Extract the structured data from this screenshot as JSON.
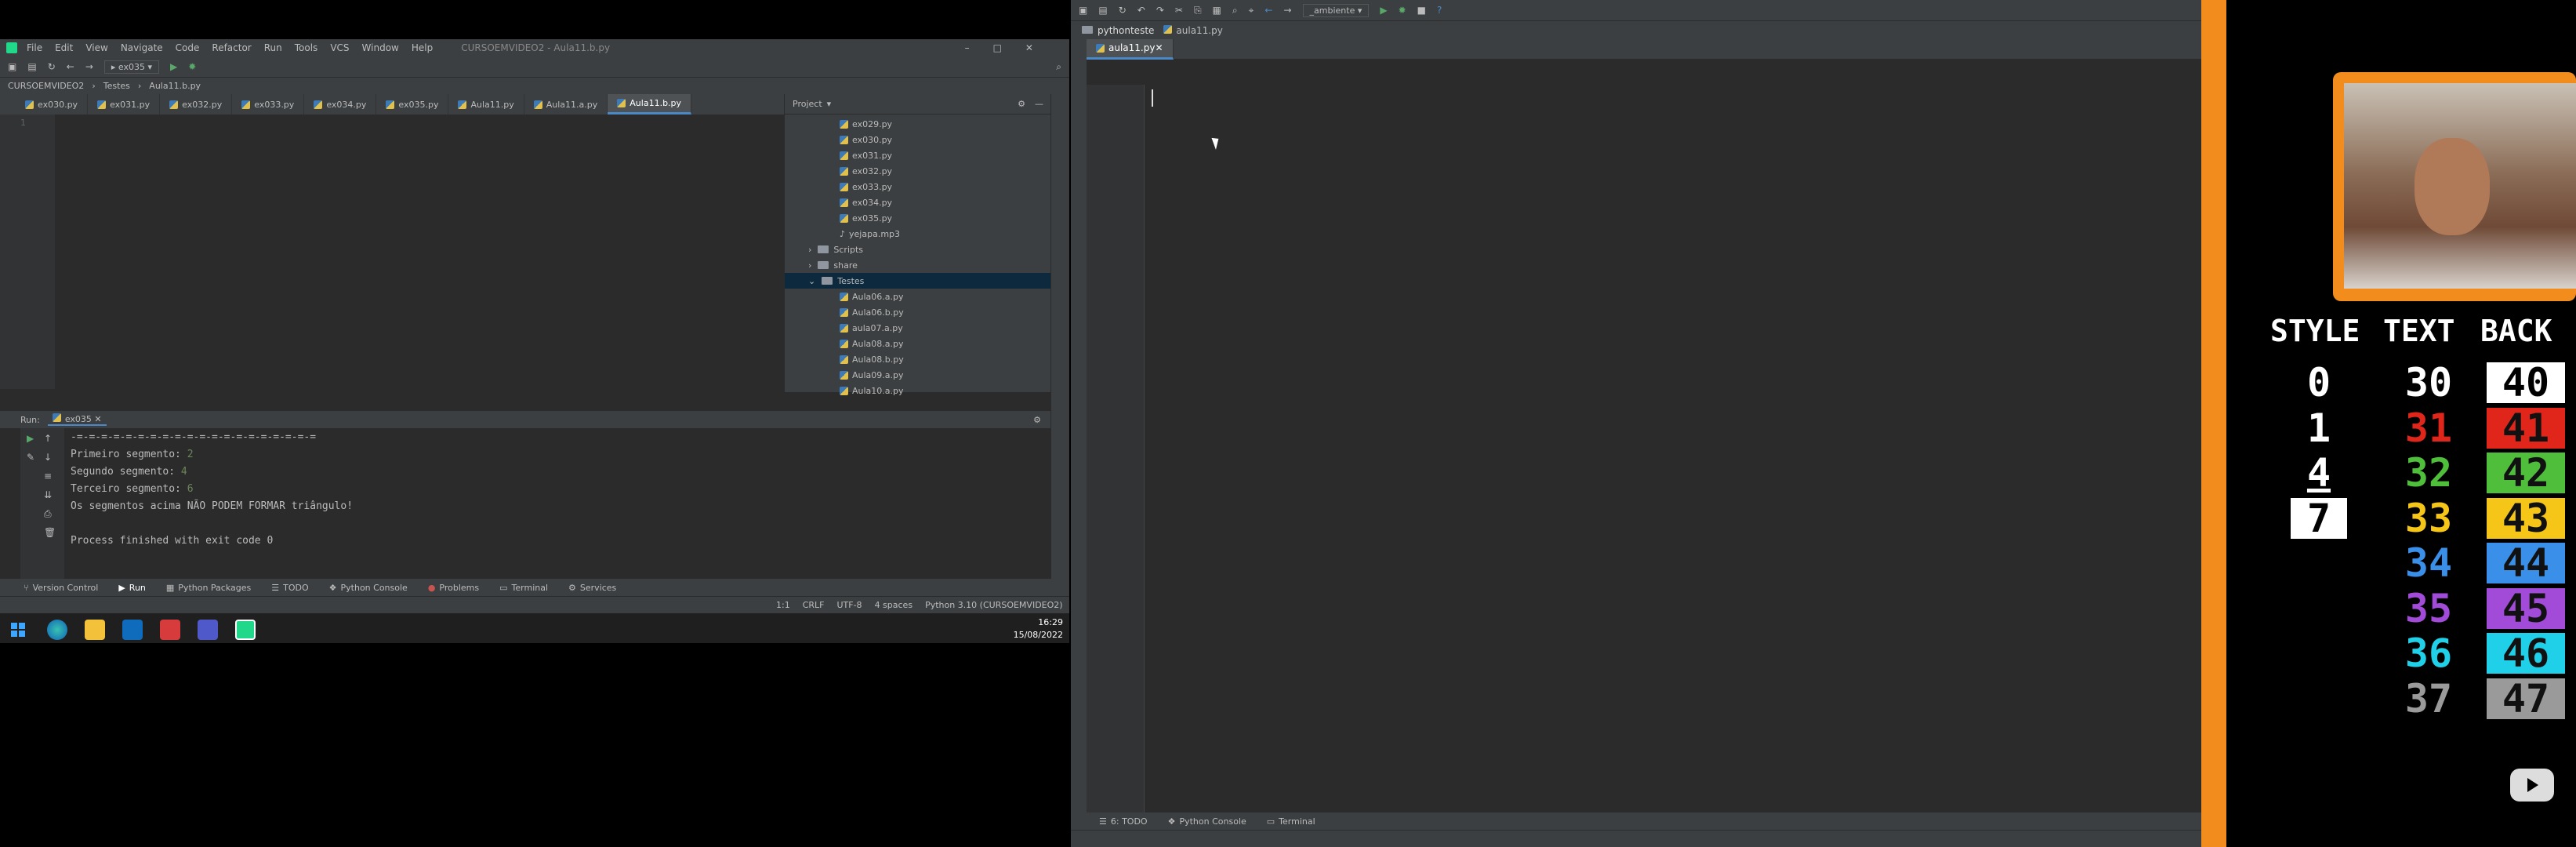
{
  "left_ide": {
    "title": "CURSOEMVIDEO2 - Aula11.b.py",
    "menu": [
      "File",
      "Edit",
      "View",
      "Navigate",
      "Code",
      "Refactor",
      "Run",
      "Tools",
      "VCS",
      "Window",
      "Help"
    ],
    "run_config": "ex035",
    "breadcrumb": [
      "CURSOEMVIDEO2",
      "Testes",
      "Aula11.b.py"
    ],
    "tabs": [
      "ex030.py",
      "ex031.py",
      "ex032.py",
      "ex033.py",
      "ex034.py",
      "ex035.py",
      "Aula11.py",
      "Aula11.a.py",
      "Aula11.b.py"
    ],
    "line_number": "1",
    "project_label": "Project",
    "tree": [
      "ex029.py",
      "ex030.py",
      "ex031.py",
      "ex032.py",
      "ex033.py",
      "ex034.py",
      "ex035.py",
      "yejapa.mp3",
      "Scripts",
      "share",
      "Testes",
      "Aula06.a.py",
      "Aula06.b.py",
      "aula07.a.py",
      "Aula08.a.py",
      "Aula08.b.py",
      "Aula09.a.py",
      "Aula10.a.py"
    ],
    "run_label": "Run:",
    "run_tab": "ex035",
    "console": {
      "separator": "-=-=-=-=-=-=-=-=-=-=-=-=-=-=-=-=-=-=-=-=",
      "l1_label": "Primeiro segmento: ",
      "l1_val": "2",
      "l2_label": "Segundo segmento: ",
      "l2_val": "4",
      "l3_label": "Terceiro segmento: ",
      "l3_val": "6",
      "result": "Os segmentos acima NÃO PODEM FORMAR triângulo!",
      "exit": "Process finished with exit code 0"
    },
    "bottom_tabs": [
      "Version Control",
      "Run",
      "Python Packages",
      "TODO",
      "Python Console",
      "Problems",
      "Terminal",
      "Services"
    ],
    "status": [
      "1:1",
      "CRLF",
      "UTF-8",
      "4 spaces",
      "Python 3.10 (CURSOEMVIDEO2)"
    ],
    "clock": {
      "time": "16:29",
      "date": "15/08/2022"
    }
  },
  "right_ide": {
    "project": "pythonteste",
    "file": "aula11.py",
    "tab": "aula11.py",
    "config": "_ambiente",
    "bottom_tabs": [
      "6: TODO",
      "Python Console",
      "Terminal"
    ]
  },
  "ansi_table": {
    "headers": [
      "STYLE",
      "TEXT",
      "BACK"
    ],
    "style": [
      "0",
      "1",
      "4",
      "7"
    ],
    "text": [
      "30",
      "31",
      "32",
      "33",
      "34",
      "35",
      "36",
      "37"
    ],
    "back": [
      "40",
      "41",
      "42",
      "43",
      "44",
      "45",
      "46",
      "47"
    ],
    "colors": [
      "#ffffff",
      "#e0261b",
      "#4ebe3b",
      "#f5c518",
      "#3a8fe8",
      "#a24bd9",
      "#1fd0e8",
      "#9a9a9a"
    ]
  }
}
